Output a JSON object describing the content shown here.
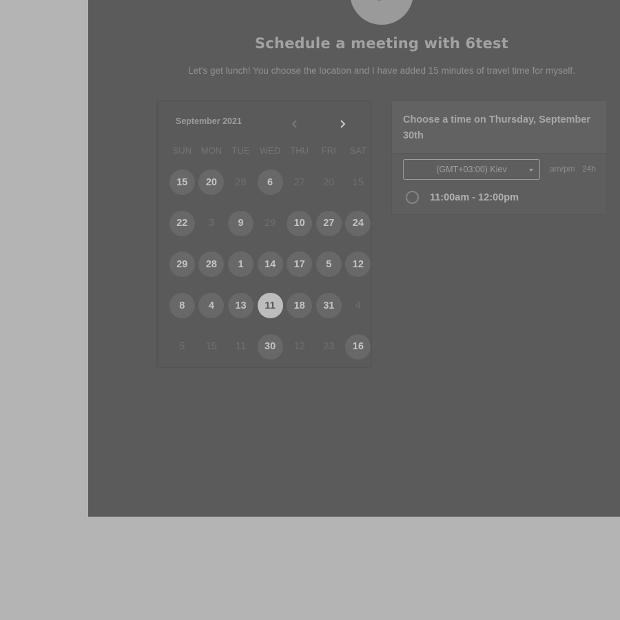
{
  "header": {
    "title": "Schedule a meeting with 6test",
    "description": "Let's get lunch! You choose the location and I have added 15 minutes of travel time for myself.",
    "avatar_initial": "a"
  },
  "calendar": {
    "month_label": "September 2021",
    "days_of_week": [
      "SUN",
      "MON",
      "TUE",
      "WED",
      "THU",
      "FRI",
      "SAT"
    ],
    "weeks": [
      [
        {
          "label": "15",
          "available": true
        },
        {
          "label": "20",
          "available": true
        },
        {
          "label": "28",
          "available": false
        },
        {
          "label": "6",
          "available": true
        },
        {
          "label": "27",
          "available": false
        },
        {
          "label": "20",
          "available": false
        },
        {
          "label": "15",
          "available": false
        }
      ],
      [
        {
          "label": "22",
          "available": true
        },
        {
          "label": "3",
          "available": false
        },
        {
          "label": "9",
          "available": true
        },
        {
          "label": "29",
          "available": false
        },
        {
          "label": "10",
          "available": true
        },
        {
          "label": "27",
          "available": true
        },
        {
          "label": "24",
          "available": true
        }
      ],
      [
        {
          "label": "29",
          "available": true
        },
        {
          "label": "28",
          "available": true
        },
        {
          "label": "1",
          "available": true
        },
        {
          "label": "14",
          "available": true
        },
        {
          "label": "17",
          "available": true
        },
        {
          "label": "5",
          "available": true
        },
        {
          "label": "12",
          "available": true
        }
      ],
      [
        {
          "label": "8",
          "available": true
        },
        {
          "label": "4",
          "available": true
        },
        {
          "label": "13",
          "available": true
        },
        {
          "label": "11",
          "available": true,
          "selected": true
        },
        {
          "label": "18",
          "available": true
        },
        {
          "label": "31",
          "available": true
        },
        {
          "label": "4",
          "available": false
        }
      ],
      [
        {
          "label": "5",
          "available": false
        },
        {
          "label": "15",
          "available": false
        },
        {
          "label": "11",
          "available": false
        },
        {
          "label": "30",
          "available": true
        },
        {
          "label": "12",
          "available": false
        },
        {
          "label": "23",
          "available": false
        },
        {
          "label": "16",
          "available": true
        }
      ]
    ]
  },
  "times": {
    "heading": "Choose a time on Thursday, September 30th",
    "timezone": "(GMT+03:00) Kiev",
    "format_12h": "am/pm",
    "format_24h": "24h",
    "slots": [
      "11:00am - 12:00pm"
    ]
  },
  "colors": {
    "backdrop": "#b4b4b4",
    "panel": "#5b5b5b",
    "selected_day": "#bdbdbd"
  },
  "icons": {
    "prev_month": "chevron-left-icon",
    "next_month": "chevron-right-icon",
    "timezone_dropdown": "caret-down-icon"
  }
}
